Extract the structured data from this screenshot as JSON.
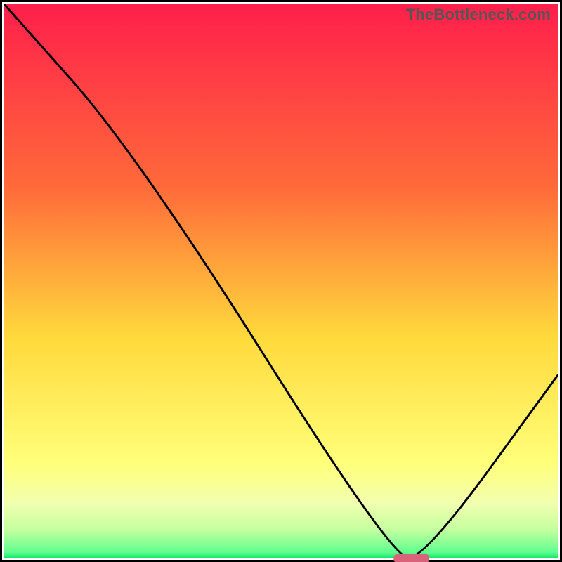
{
  "watermark": "TheBottleneck.com",
  "chart_data": {
    "type": "line",
    "title": "",
    "xlabel": "",
    "ylabel": "",
    "xlim": [
      0,
      100
    ],
    "ylim": [
      0,
      100
    ],
    "grid": false,
    "legend": false,
    "series": [
      {
        "name": "bottleneck-curve",
        "x": [
          0,
          24,
          70,
          76,
          100
        ],
        "y": [
          100,
          73,
          0,
          0,
          33
        ]
      }
    ],
    "marker": {
      "name": "optimal-range",
      "x_center": 73,
      "y": 0.6,
      "width_pct": 6.5,
      "color": "#d9637a"
    },
    "background": {
      "type": "vertical-gradient",
      "stops": [
        {
          "pct": 0,
          "color": "#ff1f4b"
        },
        {
          "pct": 33,
          "color": "#ff6a3a"
        },
        {
          "pct": 60,
          "color": "#ffd93b"
        },
        {
          "pct": 83,
          "color": "#ffff7a"
        },
        {
          "pct": 90,
          "color": "#f2ffae"
        },
        {
          "pct": 95,
          "color": "#c4ffa0"
        },
        {
          "pct": 99,
          "color": "#5fff8e"
        },
        {
          "pct": 100,
          "color": "#17e86d"
        }
      ]
    }
  }
}
